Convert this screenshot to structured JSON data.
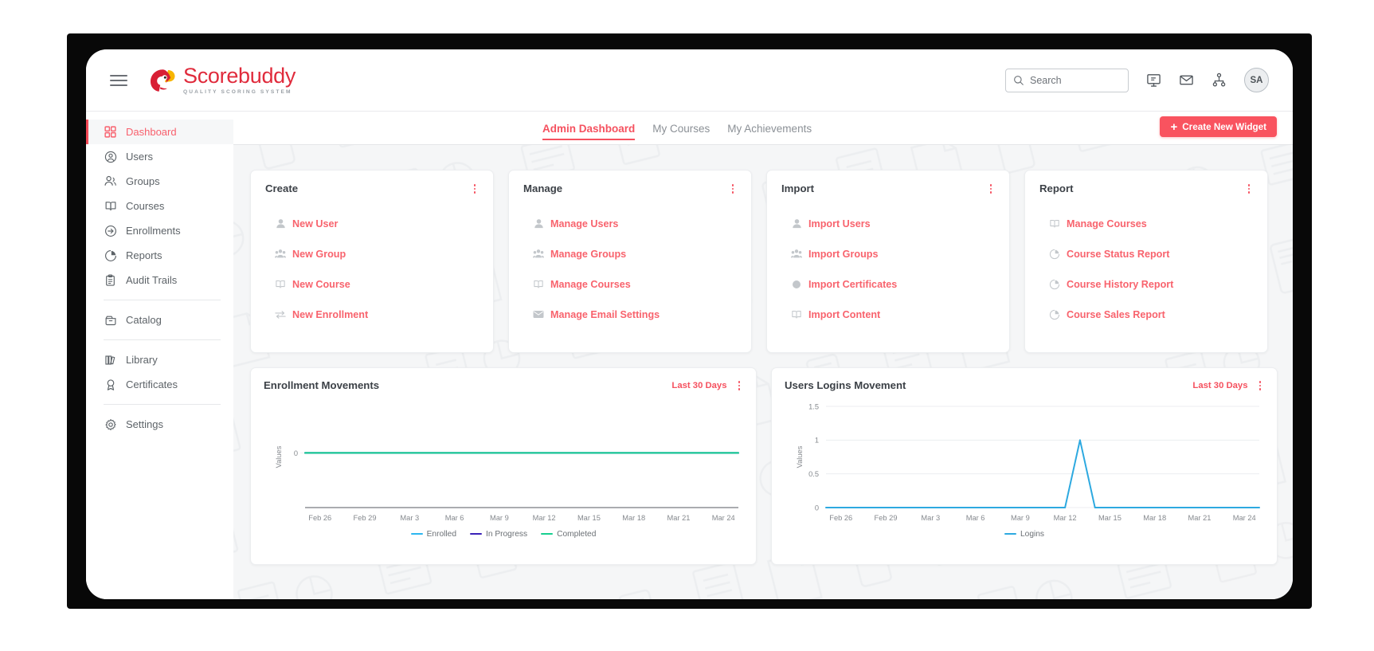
{
  "brand": {
    "name": "Scorebuddy",
    "tagline": "QUALITY SCORING SYSTEM",
    "accent": "#e02b3c"
  },
  "header": {
    "menu_icon": "hamburger-icon",
    "search": {
      "placeholder": "Search",
      "value": "",
      "icon": "search-icon"
    },
    "icons": [
      {
        "name": "presentation-icon",
        "label": "Presentation"
      },
      {
        "name": "envelope-icon",
        "label": "Messages"
      },
      {
        "name": "org-chart-icon",
        "label": "Organization"
      }
    ],
    "avatar": {
      "initials": "SA"
    }
  },
  "sidebar": {
    "items": [
      {
        "label": "Dashboard",
        "icon": "grid-icon",
        "active": true
      },
      {
        "label": "Users",
        "icon": "user-circle-icon",
        "active": false
      },
      {
        "label": "Groups",
        "icon": "users-icon",
        "active": false
      },
      {
        "label": "Courses",
        "icon": "book-icon",
        "active": false
      },
      {
        "label": "Enrollments",
        "icon": "arrow-circle-icon",
        "active": false
      },
      {
        "label": "Reports",
        "icon": "pie-chart-icon",
        "active": false
      },
      {
        "label": "Audit Trails",
        "icon": "clipboard-icon",
        "active": false
      },
      {
        "label": "Catalog",
        "icon": "archive-icon",
        "active": false
      },
      {
        "label": "Library",
        "icon": "library-icon",
        "active": false
      },
      {
        "label": "Certificates",
        "icon": "award-icon",
        "active": false
      },
      {
        "label": "Settings",
        "icon": "gear-icon",
        "active": false
      }
    ]
  },
  "tabs": [
    {
      "label": "Admin Dashboard",
      "active": true
    },
    {
      "label": "My Courses",
      "active": false
    },
    {
      "label": "My Achievements",
      "active": false
    }
  ],
  "toolbar": {
    "create_widget_label": "Create New Widget",
    "plus": "+"
  },
  "cards": [
    {
      "title": "Create",
      "links": [
        {
          "label": "New User",
          "icon": "user-icon"
        },
        {
          "label": "New Group",
          "icon": "group-icon"
        },
        {
          "label": "New Course",
          "icon": "book-icon"
        },
        {
          "label": "New Enrollment",
          "icon": "transfer-icon"
        }
      ]
    },
    {
      "title": "Manage",
      "links": [
        {
          "label": "Manage Users",
          "icon": "user-icon"
        },
        {
          "label": "Manage Groups",
          "icon": "group-icon"
        },
        {
          "label": "Manage Courses",
          "icon": "book-icon"
        },
        {
          "label": "Manage Email Settings",
          "icon": "envelope-icon"
        }
      ]
    },
    {
      "title": "Import",
      "links": [
        {
          "label": "Import Users",
          "icon": "user-icon"
        },
        {
          "label": "Import Groups",
          "icon": "group-icon"
        },
        {
          "label": "Import Certificates",
          "icon": "circle-icon"
        },
        {
          "label": "Import Content",
          "icon": "book-icon"
        }
      ]
    },
    {
      "title": "Report",
      "links": [
        {
          "label": "Manage Courses",
          "icon": "book-icon"
        },
        {
          "label": "Course Status Report",
          "icon": "pie-chart-icon"
        },
        {
          "label": "Course History Report",
          "icon": "pie-chart-icon"
        },
        {
          "label": "Course Sales Report",
          "icon": "pie-chart-icon"
        }
      ]
    }
  ],
  "chart_data": [
    {
      "type": "line",
      "title": "Enrollment Movements",
      "range_label": "Last 30 Days",
      "xlabel": "",
      "ylabel": "Values",
      "ylim": [
        0,
        0
      ],
      "yticks": [
        "0"
      ],
      "grid": false,
      "legend_position": "bottom",
      "categories": [
        "Feb 26",
        "Feb 29",
        "Mar 3",
        "Mar 6",
        "Mar 9",
        "Mar 12",
        "Mar 15",
        "Mar 18",
        "Mar 21",
        "Mar 24"
      ],
      "x": [
        "Feb 25",
        "Feb 26",
        "Feb 27",
        "Feb 28",
        "Feb 29",
        "Mar 1",
        "Mar 2",
        "Mar 3",
        "Mar 4",
        "Mar 5",
        "Mar 6",
        "Mar 7",
        "Mar 8",
        "Mar 9",
        "Mar 10",
        "Mar 11",
        "Mar 12",
        "Mar 13",
        "Mar 14",
        "Mar 15",
        "Mar 16",
        "Mar 17",
        "Mar 18",
        "Mar 19",
        "Mar 20",
        "Mar 21",
        "Mar 22",
        "Mar 23",
        "Mar 24",
        "Mar 25"
      ],
      "series": [
        {
          "name": "Enrolled",
          "color": "#2cb7f0",
          "values": [
            0,
            0,
            0,
            0,
            0,
            0,
            0,
            0,
            0,
            0,
            0,
            0,
            0,
            0,
            0,
            0,
            0,
            0,
            0,
            0,
            0,
            0,
            0,
            0,
            0,
            0,
            0,
            0,
            0,
            0
          ]
        },
        {
          "name": "In Progress",
          "color": "#3a22b8",
          "values": [
            0,
            0,
            0,
            0,
            0,
            0,
            0,
            0,
            0,
            0,
            0,
            0,
            0,
            0,
            0,
            0,
            0,
            0,
            0,
            0,
            0,
            0,
            0,
            0,
            0,
            0,
            0,
            0,
            0,
            0
          ]
        },
        {
          "name": "Completed",
          "color": "#16cf8f",
          "values": [
            0,
            0,
            0,
            0,
            0,
            0,
            0,
            0,
            0,
            0,
            0,
            0,
            0,
            0,
            0,
            0,
            0,
            0,
            0,
            0,
            0,
            0,
            0,
            0,
            0,
            0,
            0,
            0,
            0,
            0
          ]
        }
      ]
    },
    {
      "type": "line",
      "title": "Users Logins Movement",
      "range_label": "Last 30 Days",
      "xlabel": "",
      "ylabel": "Values",
      "ylim": [
        0,
        1.5
      ],
      "yticks": [
        "1.5",
        "1",
        "0.5",
        "0"
      ],
      "grid": true,
      "legend_position": "bottom",
      "categories": [
        "Feb 26",
        "Feb 29",
        "Mar 3",
        "Mar 6",
        "Mar 9",
        "Mar 12",
        "Mar 15",
        "Mar 18",
        "Mar 21",
        "Mar 24"
      ],
      "x": [
        "Feb 25",
        "Feb 26",
        "Feb 27",
        "Feb 28",
        "Feb 29",
        "Mar 1",
        "Mar 2",
        "Mar 3",
        "Mar 4",
        "Mar 5",
        "Mar 6",
        "Mar 7",
        "Mar 8",
        "Mar 9",
        "Mar 10",
        "Mar 11",
        "Mar 12",
        "Mar 13",
        "Mar 14",
        "Mar 15",
        "Mar 16",
        "Mar 17",
        "Mar 18",
        "Mar 19",
        "Mar 20",
        "Mar 21",
        "Mar 22",
        "Mar 23",
        "Mar 24",
        "Mar 25"
      ],
      "series": [
        {
          "name": "Logins",
          "color": "#2da9e0",
          "values": [
            0,
            0,
            0,
            0,
            0,
            0,
            0,
            0,
            0,
            0,
            0,
            0,
            0,
            0,
            0,
            0,
            0,
            1,
            0,
            0,
            0,
            0,
            0,
            0,
            0,
            0,
            0,
            0,
            0,
            0
          ]
        }
      ]
    }
  ]
}
